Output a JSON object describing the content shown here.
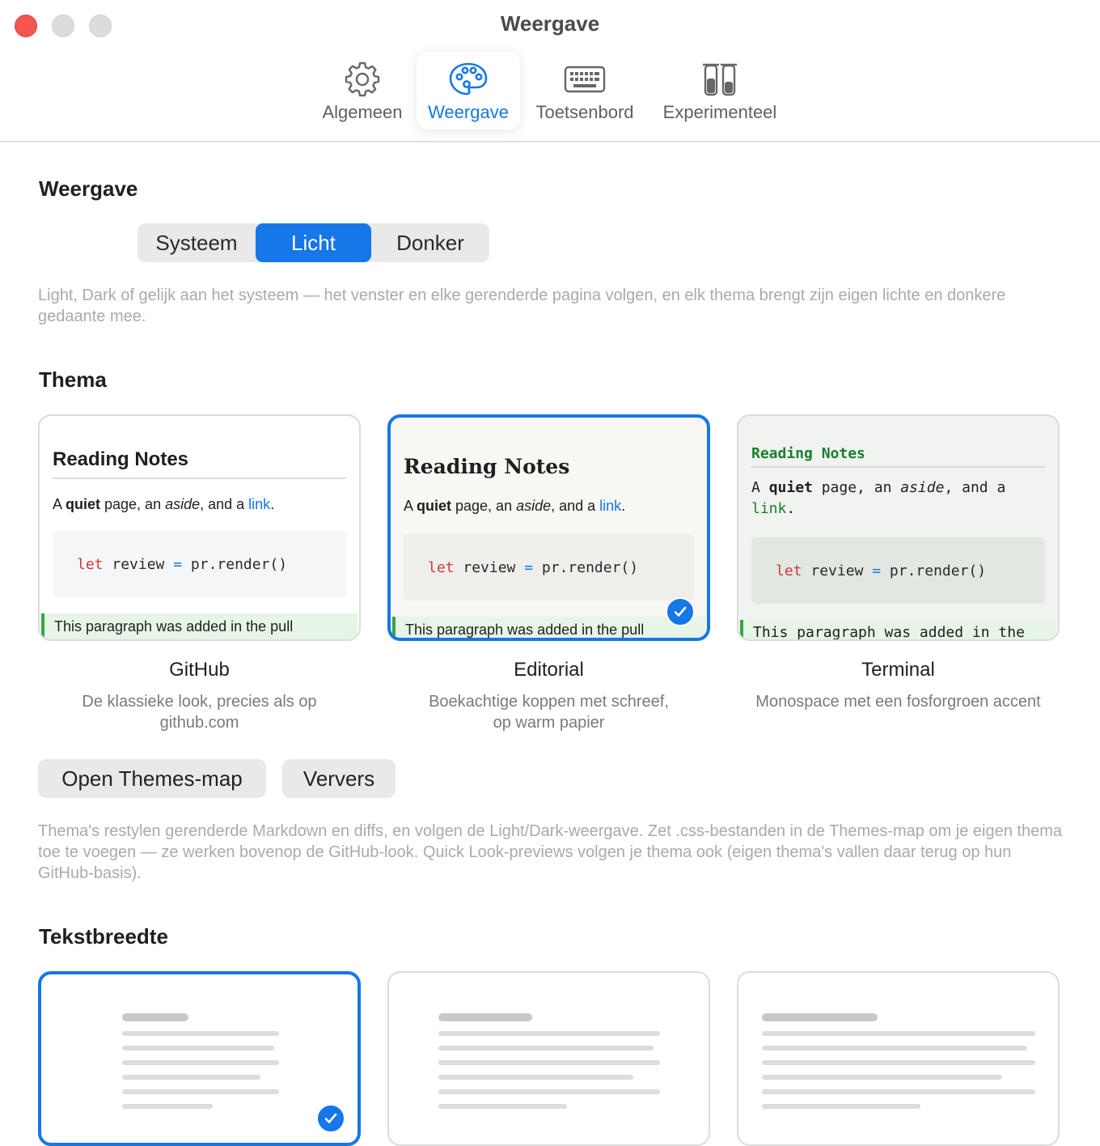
{
  "window": {
    "title": "Weergave"
  },
  "tabs": [
    {
      "label": "Algemeen",
      "icon": "gear-icon",
      "active": false
    },
    {
      "label": "Weergave",
      "icon": "palette-icon",
      "active": true
    },
    {
      "label": "Toetsenbord",
      "icon": "keyboard-icon",
      "active": false
    },
    {
      "label": "Experimenteel",
      "icon": "test-tubes-icon",
      "active": false
    }
  ],
  "appearance": {
    "heading": "Weergave",
    "options": [
      "Systeem",
      "Licht",
      "Donker"
    ],
    "selected": "Licht",
    "help": "Light, Dark of gelijk aan het systeem — het venster en elke gerenderde pagina volgen, en elk thema brengt zijn eigen lichte en donkere gedaante mee."
  },
  "theme": {
    "heading": "Thema",
    "preview": {
      "title": "Reading Notes",
      "para_a": "A ",
      "para_bold": "quiet",
      "para_b": " page, an ",
      "para_italic": "aside",
      "para_c": ", and a ",
      "para_link": "link",
      "para_d": ".",
      "code_kw": "let",
      "code_ident": " review ",
      "code_op": "=",
      "code_rest": " pr.render()",
      "added_line_proportional": "This paragraph was added in the pull",
      "added_line_mono": "This paragraph was added in the"
    },
    "cards": [
      {
        "name": "GitHub",
        "desc": "De klassieke look, precies als op github.com",
        "selected": false
      },
      {
        "name": "Editorial",
        "desc": "Boekachtige koppen met schreef, op warm papier",
        "selected": true
      },
      {
        "name": "Terminal",
        "desc": "Monospace met een fosforgroen accent",
        "selected": false
      }
    ],
    "buttons": {
      "open": "Open Themes-map",
      "refresh": "Ververs"
    },
    "help": "Thema's restylen gerenderde Markdown en diffs, en volgen de Light/Dark-weergave. Zet .css-bestanden in de Themes-map om je eigen thema toe te voegen — ze werken bovenop de GitHub-look. Quick Look-previews volgen je thema ook (eigen thema's vallen daar terug op hun GitHub-basis)."
  },
  "text_width": {
    "heading": "Tekstbreedte",
    "options": [
      "narrow",
      "medium",
      "wide"
    ],
    "selected": "narrow"
  },
  "colors": {
    "accent": "#1577e8",
    "close": "#f2564f",
    "added_bg": "#e7f5e6",
    "added_bar": "#35a646",
    "terminal_green": "#1a7f2e"
  }
}
